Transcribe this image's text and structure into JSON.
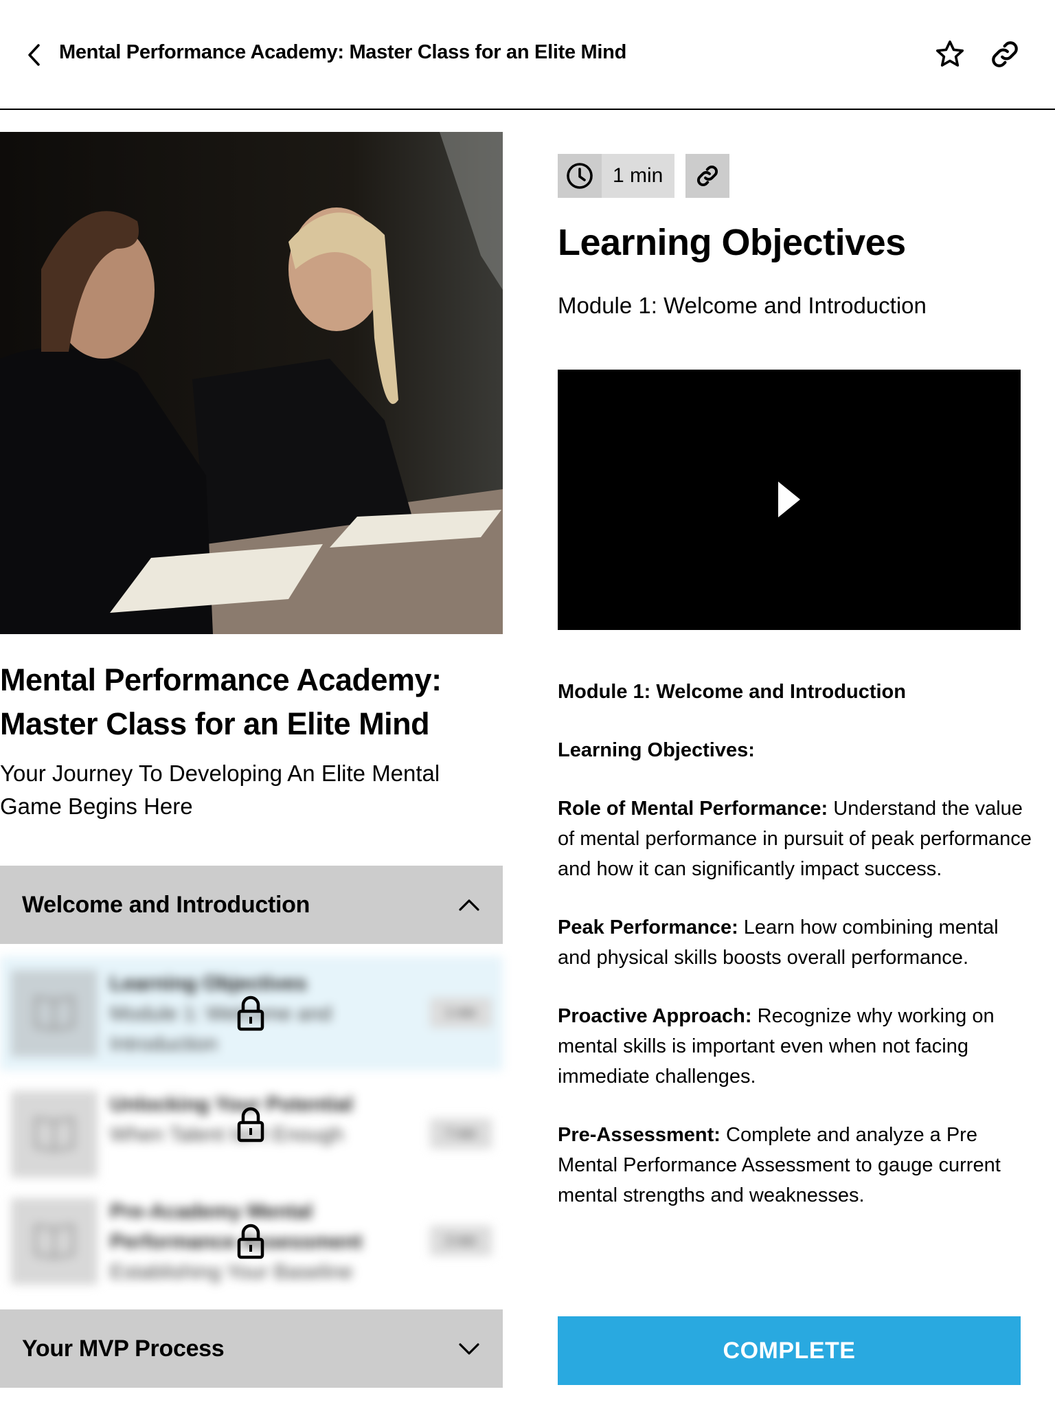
{
  "header": {
    "title": "Mental Performance Academy: Master Class for an Elite Mind",
    "back_icon": "chevron-left-icon",
    "favorite_icon": "star-icon",
    "share_icon": "link-icon"
  },
  "course": {
    "title": "Mental Performance Academy: Master Class for an Elite Mind",
    "subtitle": "Your Journey To Developing An Elite Mental Game Begins Here",
    "hero_image_alt": "Two athletes talking at a table with notebooks"
  },
  "sections": [
    {
      "title": "Welcome and Introduction",
      "expanded": true,
      "lessons": [
        {
          "title": "Learning Objectives",
          "subtitle": "Module 1: Welcome and Introduction",
          "duration": "1 min",
          "locked": true,
          "active": true
        },
        {
          "title": "Unlocking Your Potential",
          "subtitle": "When Talent Isn't Enough",
          "duration": "7 min",
          "locked": true,
          "active": false
        },
        {
          "title": "Pre-Academy Mental Performance Assessment",
          "subtitle": "Establishing Your Baseline",
          "duration": "2 min",
          "locked": true,
          "active": false
        }
      ]
    },
    {
      "title": "Your MVP Process",
      "expanded": false,
      "lessons": []
    }
  ],
  "lesson": {
    "duration": "1 min",
    "title": "Learning Objectives",
    "subtitle": "Module 1: Welcome and Introduction",
    "body": {
      "heading": "Module 1: Welcome and Introduction",
      "subheading": "Learning Objectives:",
      "objectives": [
        {
          "label": "Role of Mental Performance:",
          "text": " Understand the value of mental performance in pursuit of peak performance and how it can significantly impact success."
        },
        {
          "label": "Peak Performance:",
          "text": " Learn how combining mental and physical skills boosts overall performance."
        },
        {
          "label": "Proactive Approach:",
          "text": " Recognize why working on mental skills is important even when not facing immediate challenges."
        },
        {
          "label": "Pre-Assessment:",
          "text": " Complete and analyze a Pre Mental Performance Assessment to gauge current mental strengths and weaknesses."
        }
      ]
    },
    "complete_label": "COMPLETE"
  },
  "colors": {
    "accent": "#29a9e0",
    "section_header_bg": "#cccccc",
    "chip_bg": "#dcdcdc",
    "active_lesson_bg": "#e6f4fa"
  }
}
